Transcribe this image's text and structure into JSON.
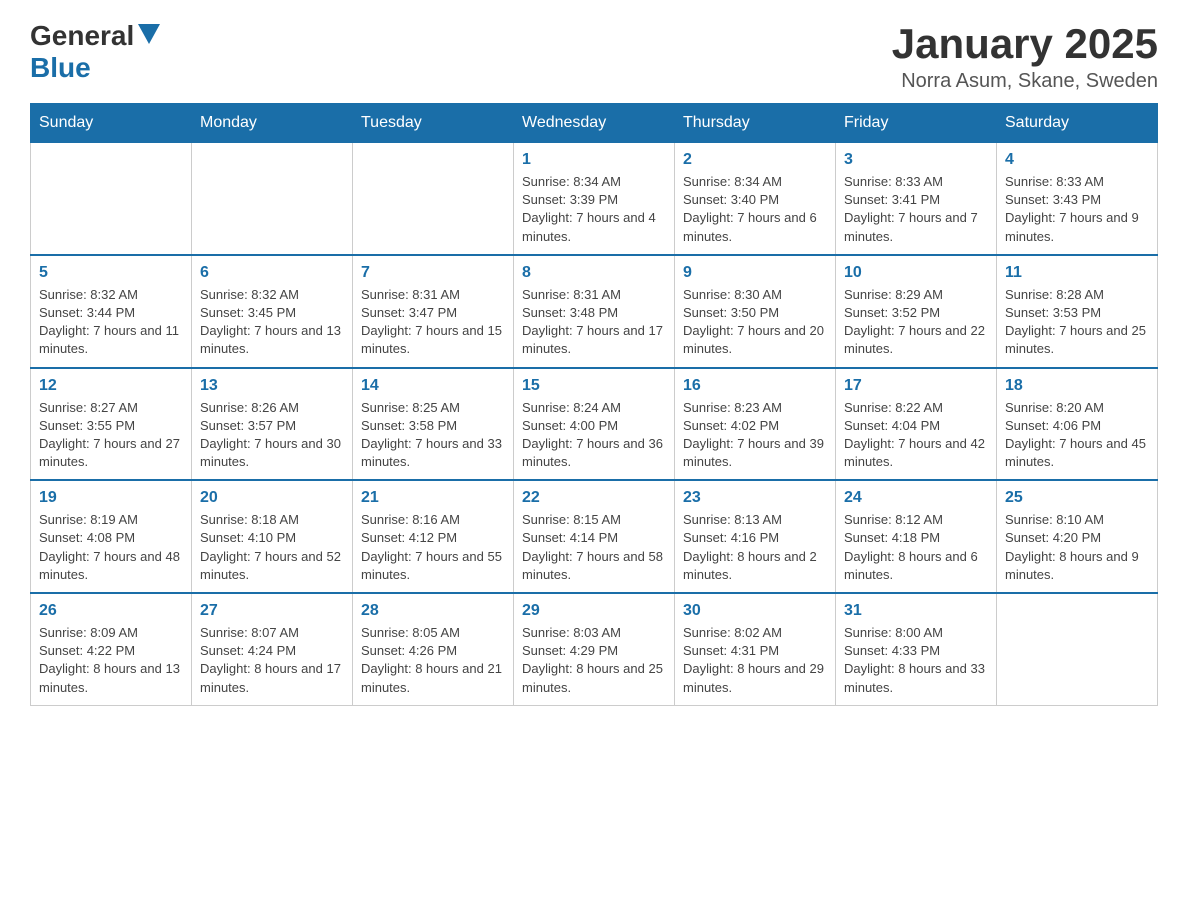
{
  "logo": {
    "general": "General",
    "blue": "Blue"
  },
  "title": "January 2025",
  "location": "Norra Asum, Skane, Sweden",
  "headers": [
    "Sunday",
    "Monday",
    "Tuesday",
    "Wednesday",
    "Thursday",
    "Friday",
    "Saturday"
  ],
  "weeks": [
    [
      {
        "day": "",
        "info": ""
      },
      {
        "day": "",
        "info": ""
      },
      {
        "day": "",
        "info": ""
      },
      {
        "day": "1",
        "info": "Sunrise: 8:34 AM\nSunset: 3:39 PM\nDaylight: 7 hours and 4 minutes."
      },
      {
        "day": "2",
        "info": "Sunrise: 8:34 AM\nSunset: 3:40 PM\nDaylight: 7 hours and 6 minutes."
      },
      {
        "day": "3",
        "info": "Sunrise: 8:33 AM\nSunset: 3:41 PM\nDaylight: 7 hours and 7 minutes."
      },
      {
        "day": "4",
        "info": "Sunrise: 8:33 AM\nSunset: 3:43 PM\nDaylight: 7 hours and 9 minutes."
      }
    ],
    [
      {
        "day": "5",
        "info": "Sunrise: 8:32 AM\nSunset: 3:44 PM\nDaylight: 7 hours and 11 minutes."
      },
      {
        "day": "6",
        "info": "Sunrise: 8:32 AM\nSunset: 3:45 PM\nDaylight: 7 hours and 13 minutes."
      },
      {
        "day": "7",
        "info": "Sunrise: 8:31 AM\nSunset: 3:47 PM\nDaylight: 7 hours and 15 minutes."
      },
      {
        "day": "8",
        "info": "Sunrise: 8:31 AM\nSunset: 3:48 PM\nDaylight: 7 hours and 17 minutes."
      },
      {
        "day": "9",
        "info": "Sunrise: 8:30 AM\nSunset: 3:50 PM\nDaylight: 7 hours and 20 minutes."
      },
      {
        "day": "10",
        "info": "Sunrise: 8:29 AM\nSunset: 3:52 PM\nDaylight: 7 hours and 22 minutes."
      },
      {
        "day": "11",
        "info": "Sunrise: 8:28 AM\nSunset: 3:53 PM\nDaylight: 7 hours and 25 minutes."
      }
    ],
    [
      {
        "day": "12",
        "info": "Sunrise: 8:27 AM\nSunset: 3:55 PM\nDaylight: 7 hours and 27 minutes."
      },
      {
        "day": "13",
        "info": "Sunrise: 8:26 AM\nSunset: 3:57 PM\nDaylight: 7 hours and 30 minutes."
      },
      {
        "day": "14",
        "info": "Sunrise: 8:25 AM\nSunset: 3:58 PM\nDaylight: 7 hours and 33 minutes."
      },
      {
        "day": "15",
        "info": "Sunrise: 8:24 AM\nSunset: 4:00 PM\nDaylight: 7 hours and 36 minutes."
      },
      {
        "day": "16",
        "info": "Sunrise: 8:23 AM\nSunset: 4:02 PM\nDaylight: 7 hours and 39 minutes."
      },
      {
        "day": "17",
        "info": "Sunrise: 8:22 AM\nSunset: 4:04 PM\nDaylight: 7 hours and 42 minutes."
      },
      {
        "day": "18",
        "info": "Sunrise: 8:20 AM\nSunset: 4:06 PM\nDaylight: 7 hours and 45 minutes."
      }
    ],
    [
      {
        "day": "19",
        "info": "Sunrise: 8:19 AM\nSunset: 4:08 PM\nDaylight: 7 hours and 48 minutes."
      },
      {
        "day": "20",
        "info": "Sunrise: 8:18 AM\nSunset: 4:10 PM\nDaylight: 7 hours and 52 minutes."
      },
      {
        "day": "21",
        "info": "Sunrise: 8:16 AM\nSunset: 4:12 PM\nDaylight: 7 hours and 55 minutes."
      },
      {
        "day": "22",
        "info": "Sunrise: 8:15 AM\nSunset: 4:14 PM\nDaylight: 7 hours and 58 minutes."
      },
      {
        "day": "23",
        "info": "Sunrise: 8:13 AM\nSunset: 4:16 PM\nDaylight: 8 hours and 2 minutes."
      },
      {
        "day": "24",
        "info": "Sunrise: 8:12 AM\nSunset: 4:18 PM\nDaylight: 8 hours and 6 minutes."
      },
      {
        "day": "25",
        "info": "Sunrise: 8:10 AM\nSunset: 4:20 PM\nDaylight: 8 hours and 9 minutes."
      }
    ],
    [
      {
        "day": "26",
        "info": "Sunrise: 8:09 AM\nSunset: 4:22 PM\nDaylight: 8 hours and 13 minutes."
      },
      {
        "day": "27",
        "info": "Sunrise: 8:07 AM\nSunset: 4:24 PM\nDaylight: 8 hours and 17 minutes."
      },
      {
        "day": "28",
        "info": "Sunrise: 8:05 AM\nSunset: 4:26 PM\nDaylight: 8 hours and 21 minutes."
      },
      {
        "day": "29",
        "info": "Sunrise: 8:03 AM\nSunset: 4:29 PM\nDaylight: 8 hours and 25 minutes."
      },
      {
        "day": "30",
        "info": "Sunrise: 8:02 AM\nSunset: 4:31 PM\nDaylight: 8 hours and 29 minutes."
      },
      {
        "day": "31",
        "info": "Sunrise: 8:00 AM\nSunset: 4:33 PM\nDaylight: 8 hours and 33 minutes."
      },
      {
        "day": "",
        "info": ""
      }
    ]
  ]
}
